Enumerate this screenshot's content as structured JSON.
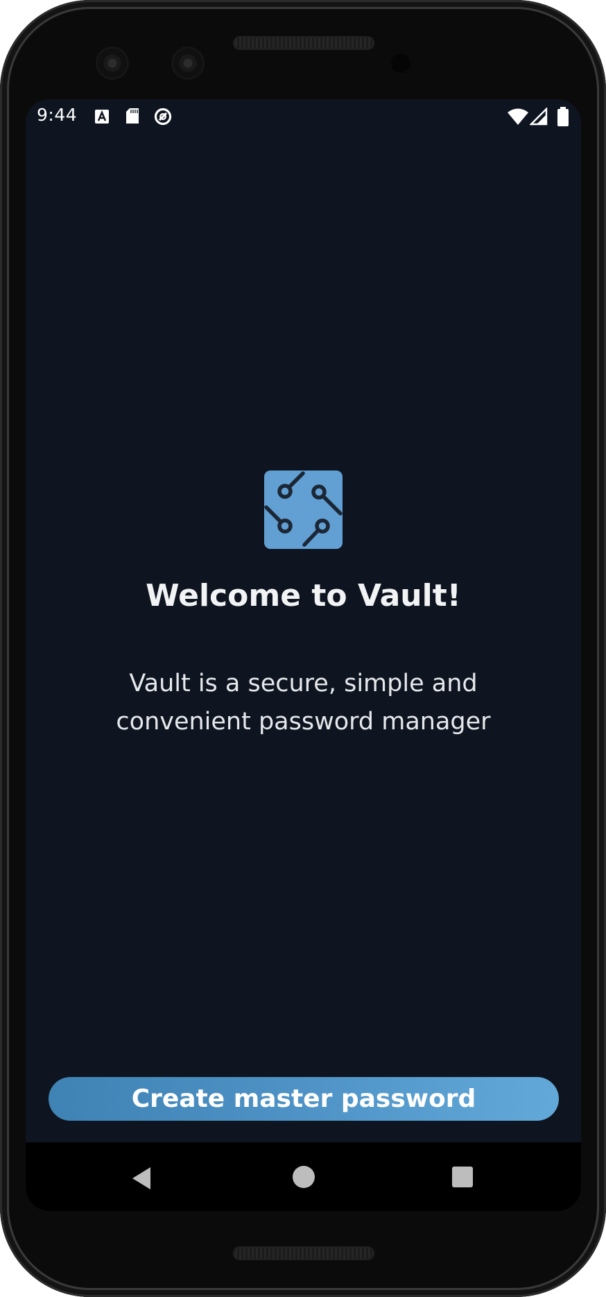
{
  "status_bar": {
    "time": "9:44",
    "left_icons": [
      "font-a-icon",
      "sd-card-icon",
      "data-saver-icon"
    ],
    "right_icons": [
      "wifi-icon",
      "cell-signal-icon",
      "battery-icon"
    ]
  },
  "welcome": {
    "logo_icon": "vault-circuit-logo-icon",
    "title": "Welcome to Vault!",
    "description": "Vault is a secure, simple and convenient password manager"
  },
  "actions": {
    "create_master_password_label": "Create master password"
  },
  "nav_bar": {
    "icons": [
      "back-triangle-icon",
      "home-circle-icon",
      "recents-square-icon"
    ]
  },
  "colors": {
    "screen_background": "#0f1520",
    "logo_fill": "#62a0d3",
    "button_gradient_start": "#3f83b5",
    "button_gradient_end": "#62a9d9",
    "text_primary": "#f2f3f5"
  }
}
